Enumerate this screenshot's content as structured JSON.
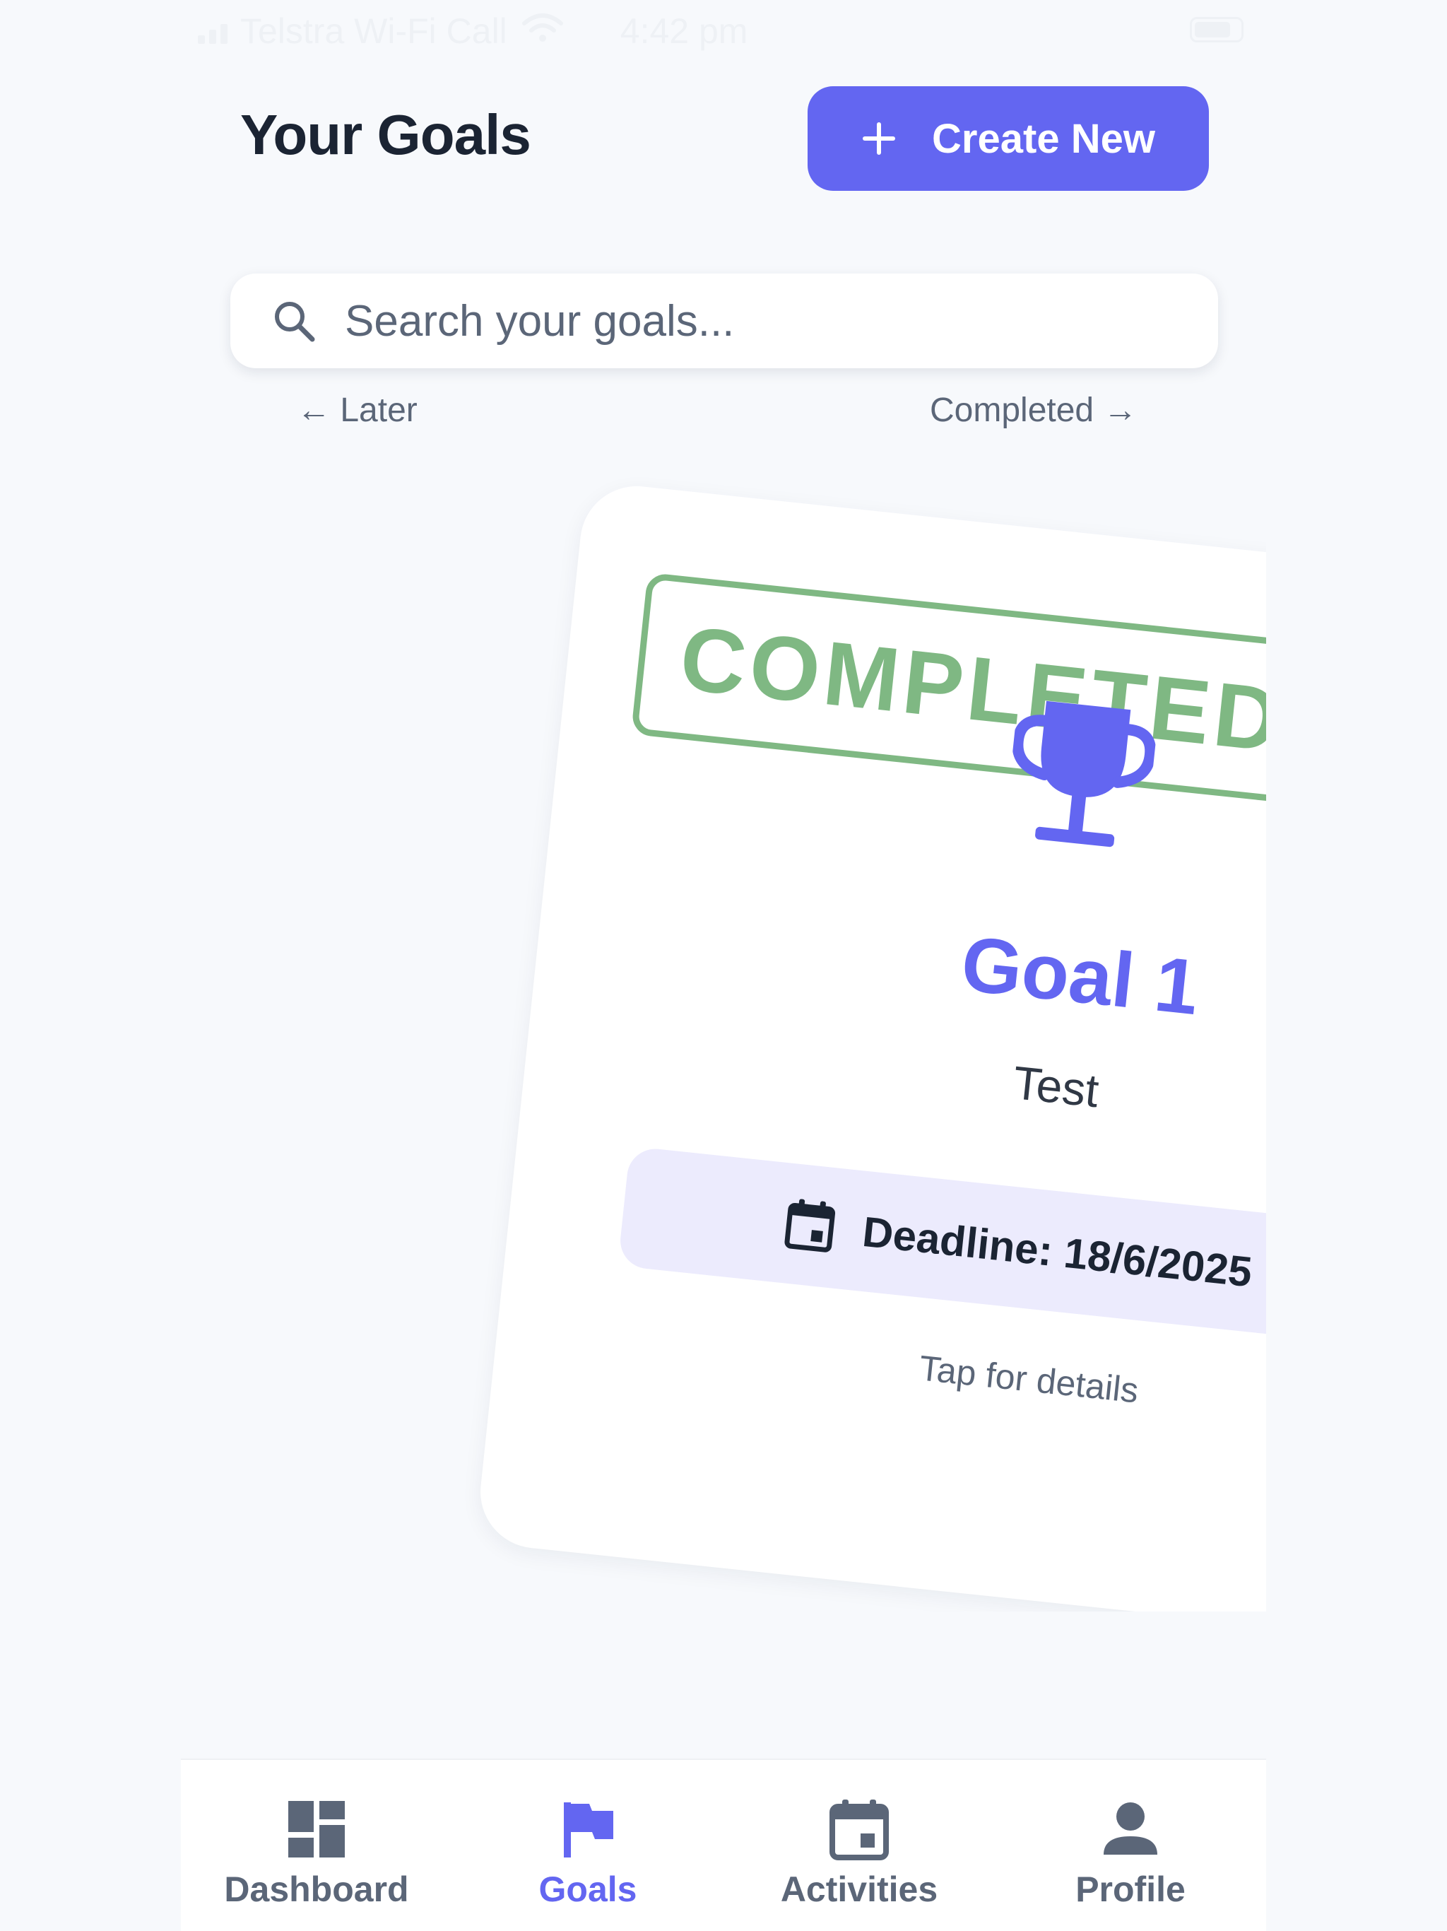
{
  "status_bar": {
    "carrier": "Telstra Wi-Fi Call",
    "time": "4:42 pm"
  },
  "header": {
    "title": "Your Goals",
    "create_button_label": "Create New"
  },
  "search": {
    "placeholder": "Search your goals...",
    "value": ""
  },
  "swipe_hints": {
    "left": "← Later",
    "right": "Completed →"
  },
  "goal_card": {
    "stamp": "COMPLETED",
    "title": "Goal 1",
    "description": "Test",
    "deadline": "Deadline: 18/6/2025",
    "tap_hint": "Tap for details"
  },
  "bottom_nav": {
    "items": [
      {
        "label": "Dashboard",
        "icon": "dashboard-icon",
        "active": false
      },
      {
        "label": "Goals",
        "icon": "flag-icon",
        "active": true
      },
      {
        "label": "Activities",
        "icon": "calendar-icon",
        "active": false
      },
      {
        "label": "Profile",
        "icon": "person-icon",
        "active": false
      }
    ]
  },
  "colors": {
    "accent": "#6366f1",
    "stamp_green": "#7fb883",
    "deadline_bg": "#ecebfd",
    "text_dark": "#1b2433",
    "text_muted": "#5b6678",
    "background": "#f7f9fc"
  }
}
